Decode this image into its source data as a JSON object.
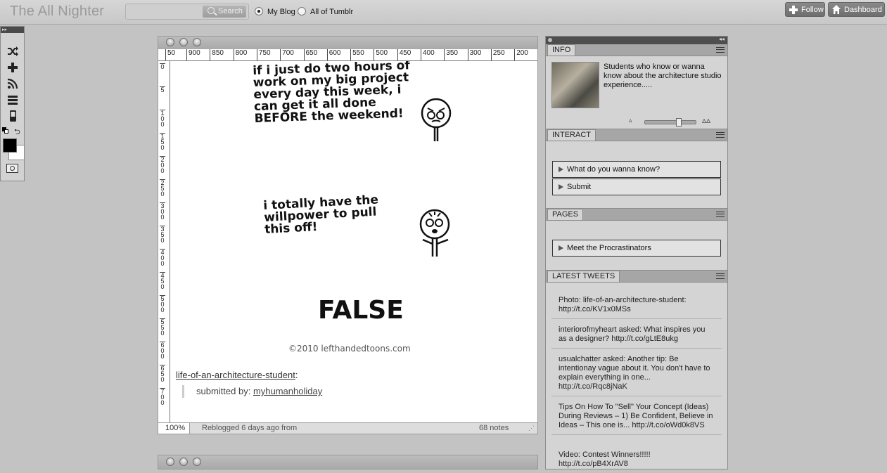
{
  "topbar": {
    "blog_title": "The All Nighter",
    "search_placeholder": "",
    "search_button": "Search",
    "radio_my_blog": "My Blog",
    "radio_all_tumblr": "All of Tumblr",
    "follow_label": "Follow",
    "dashboard_label": "Dashboard"
  },
  "tools": {
    "items": [
      "shuffle-icon",
      "plus-icon",
      "rss-icon",
      "archive-icon",
      "mobile-icon"
    ],
    "foreground_color": "#000000",
    "background_color": "#ffffff"
  },
  "post": {
    "ruler_h": [
      "50",
      "900",
      "850",
      "800",
      "750",
      "700",
      "650",
      "600",
      "550",
      "500",
      "450",
      "400",
      "350",
      "300",
      "250",
      "200"
    ],
    "ruler_v": [
      "0",
      "5",
      "1 0 0",
      "1 5 0",
      "2 0 0",
      "2 5 0",
      "3 0 0",
      "3 5 0",
      "4 0 0",
      "4 5 0",
      "5 0 0",
      "5 5 0",
      "6 0 0",
      "6 5 0",
      "7 0 0"
    ],
    "comic": {
      "panel1": [
        "if i just do two hours of",
        "work on my big project",
        "every day this week, i",
        "can get it all done",
        "BEFORE the weekend!"
      ],
      "panel2": [
        "i totally have the",
        "willpower to pull",
        "this off!"
      ],
      "panel3": "FALSE",
      "credit": "©2010  lefthandedtoons.com"
    },
    "source_link": "life-of-an-architecture-student",
    "source_colon": ":",
    "submitted_prefix": "submitted by: ",
    "submitted_by": "myhumanholiday",
    "zoom": "100%",
    "reblog_text": "Reblogged 6 days ago from",
    "notes": "68 notes"
  },
  "panel": {
    "info": {
      "tab": "INFO",
      "description": "Students who know or wanna know about the architecture studio experience....."
    },
    "interact": {
      "tab": "INTERACT",
      "items": [
        "What do you wanna know?",
        "Submit"
      ]
    },
    "pages": {
      "tab": "PAGES",
      "items": [
        "Meet the Procrastinators"
      ]
    },
    "tweets": {
      "tab": "LATEST TWEETS",
      "items": [
        "Photo: life-of-an-architecture-student: http://t.co/KV1x0MSs",
        "interiorofmyheart asked: What inspires you as a designer? http://t.co/gLtE8ukg",
        "usualchatter asked: Another tip: Be intentionay vague about it. You don't have to explain everything in one... http://t.co/Rqc8jNaK",
        "Tips On How To \"Sell\" Your Concept (Ideas) During Reviews – 1) Be Confident, Believe in Ideas – This one is... http://t.co/oWd0k8VS",
        "Video: Contest Winners!!!!! http://t.co/pB4XrAV8"
      ]
    }
  }
}
